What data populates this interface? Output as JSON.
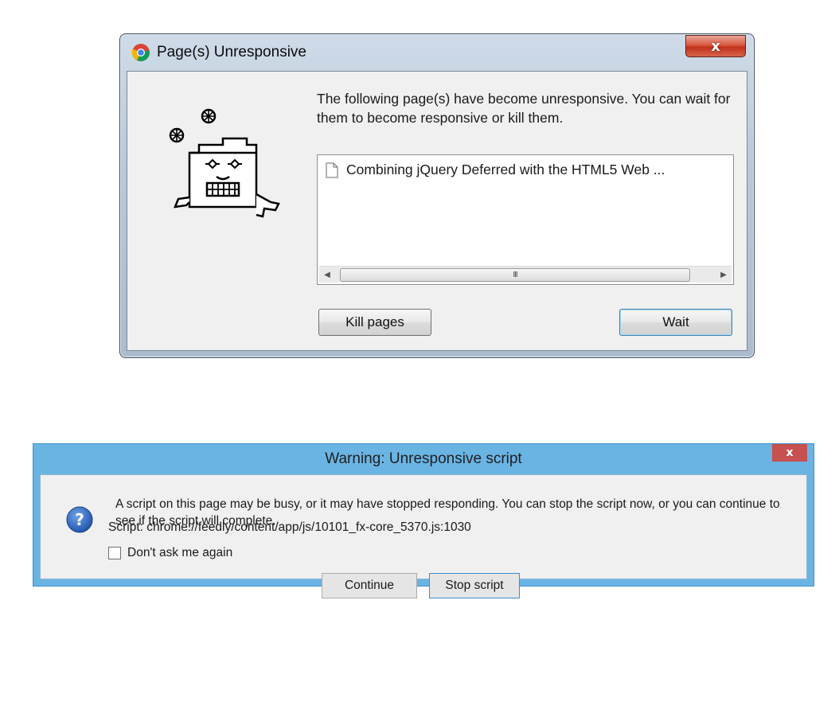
{
  "chrome_dialog": {
    "title": "Page(s) Unresponsive",
    "close_label": "x",
    "message": "The following page(s) have become unresponsive. You can wait for them to become responsive or kill them.",
    "pages": [
      {
        "title": "Combining jQuery Deferred with the HTML5 Web ..."
      }
    ],
    "scrollbar_thumb_grip": "III",
    "kill_button": "Kill pages",
    "wait_button": "Wait",
    "mascot_icon": "frozen-folder-mascot-icon",
    "page_icon": "document-icon"
  },
  "firefox_dialog": {
    "title": "Warning: Unresponsive script",
    "close_label": "x",
    "message": "A script on this page may be busy, or it may have stopped responding. You can stop the script now, or you can continue to see if the script will complete.",
    "script_line": "Script: chrome://feedly/content/app/js/10101_fx-core_5370.js:1030",
    "checkbox_label": "Don't ask me again",
    "checkbox_checked": false,
    "continue_button": "Continue",
    "stop_button": "Stop script",
    "icon": "question-icon",
    "accent_color": "#6ab4e4"
  }
}
